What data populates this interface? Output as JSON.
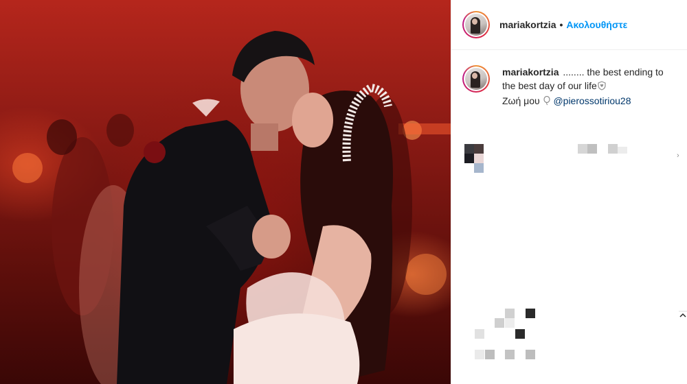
{
  "photo": {
    "alt_icon": "wedding-kiss-photo"
  },
  "header": {
    "username": "mariakortzia",
    "separator": "•",
    "follow_label": "Ακολουθήστε"
  },
  "caption": {
    "username": "mariakortzia",
    "text_part1": "........ the best ending to the best day of our life",
    "text_part2": "Ζωή μου",
    "mention": "@pierossotiriou28",
    "icon_1": "heart-shield-icon",
    "icon_2": "balloon-icon"
  },
  "colors": {
    "accent": "#0095f6",
    "mention": "#00376b",
    "text": "#262626",
    "border": "#efefef"
  }
}
